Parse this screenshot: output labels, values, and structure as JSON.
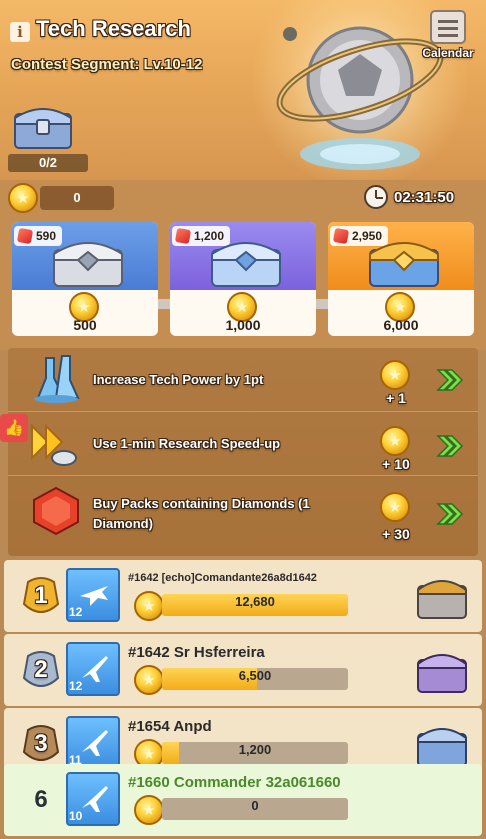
{
  "header": {
    "title": "Tech Research",
    "subtitle": "Contest Segment: Lv.10-12",
    "calendar_label": "Calendar",
    "chest_progress": "0/2"
  },
  "points": {
    "value": "0",
    "timer": "02:31:50"
  },
  "rewards": [
    {
      "cost": "590",
      "required": "500",
      "color": "#5c8ee0"
    },
    {
      "cost": "1,200",
      "required": "1,000",
      "color": "#8a74e6"
    },
    {
      "cost": "2,950",
      "required": "6,000",
      "color": "#f59a2a"
    }
  ],
  "tasks": [
    {
      "label": "Increase Tech Power by 1pt",
      "reward": "+ 1",
      "icon": "beaker-icon"
    },
    {
      "label": "Use 1-min Research Speed-up",
      "reward": "+ 10",
      "icon": "speedup-icon"
    },
    {
      "label": "Buy Packs containing Diamonds (1 Diamond)",
      "reward": "+ 30",
      "icon": "diamond-icon"
    }
  ],
  "leaderboard": [
    {
      "rank": "1",
      "name": "#1642 [echo]Comandante26a8d1642",
      "level": "12",
      "score": "12,680",
      "fill": 1.0
    },
    {
      "rank": "2",
      "name": "#1642 Sr Hsferreira",
      "level": "12",
      "score": "6,500",
      "fill": 0.51
    },
    {
      "rank": "3",
      "name": "#1654 Anpd",
      "level": "11",
      "score": "1,200",
      "fill": 0.09
    },
    {
      "rank": "6",
      "name": "#1660 Commander 32a061660",
      "level": "10",
      "score": "0",
      "fill": 0.0
    }
  ]
}
